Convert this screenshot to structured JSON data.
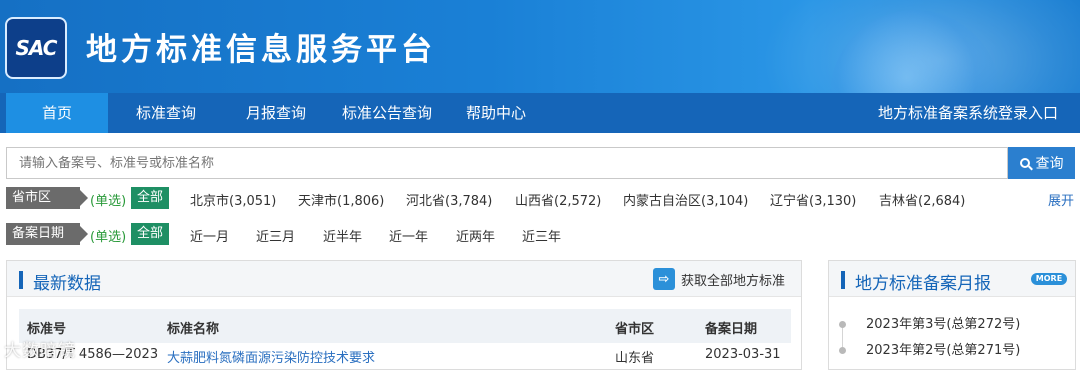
{
  "header": {
    "logo_text": "SAC",
    "title": "地方标准信息服务平台"
  },
  "nav": {
    "items": [
      {
        "label": "首页",
        "active": true
      },
      {
        "label": "标准查询",
        "active": false
      },
      {
        "label": "月报查询",
        "active": false
      },
      {
        "label": "标准公告查询",
        "active": false
      },
      {
        "label": "帮助中心",
        "active": false
      }
    ],
    "login_link": "地方标准备案系统登录入口"
  },
  "search": {
    "placeholder": "请输入备案号、标准号或标准名称",
    "button_label": "查询"
  },
  "filters": {
    "province": {
      "label": "省市区",
      "mode": "(单选)",
      "all": "全部",
      "options": [
        "北京市(3,051)",
        "天津市(1,806)",
        "河北省(3,784)",
        "山西省(2,572)",
        "内蒙古自治区(3,104)",
        "辽宁省(3,130)",
        "吉林省(2,684)"
      ],
      "expand": "展开"
    },
    "date": {
      "label": "备案日期",
      "mode": "(单选)",
      "all": "全部",
      "options": [
        "近一月",
        "近三月",
        "近半年",
        "近一年",
        "近两年",
        "近三年"
      ]
    }
  },
  "latest": {
    "title": "最新数据",
    "get_all": "获取全部地方标准",
    "columns": [
      "标准号",
      "标准名称",
      "省市区",
      "备案日期"
    ],
    "rows": [
      {
        "code": "DB37/T 4586—2023",
        "name": "大蒜肥料氮磷面源污染防控技术要求",
        "region": "山东省",
        "date": "2023-03-31"
      }
    ]
  },
  "monthly": {
    "title": "地方标准备案月报",
    "more": "MORE",
    "items": [
      "2023年第3号(总第272号)",
      "2023年第2号(总第271号)"
    ]
  },
  "watermark": "大数暗镜",
  "colors": {
    "nav_bg": "#1565b8",
    "nav_active": "#1e8fe3",
    "accent_green": "#1e8f64",
    "link_blue": "#2a6fc0"
  }
}
